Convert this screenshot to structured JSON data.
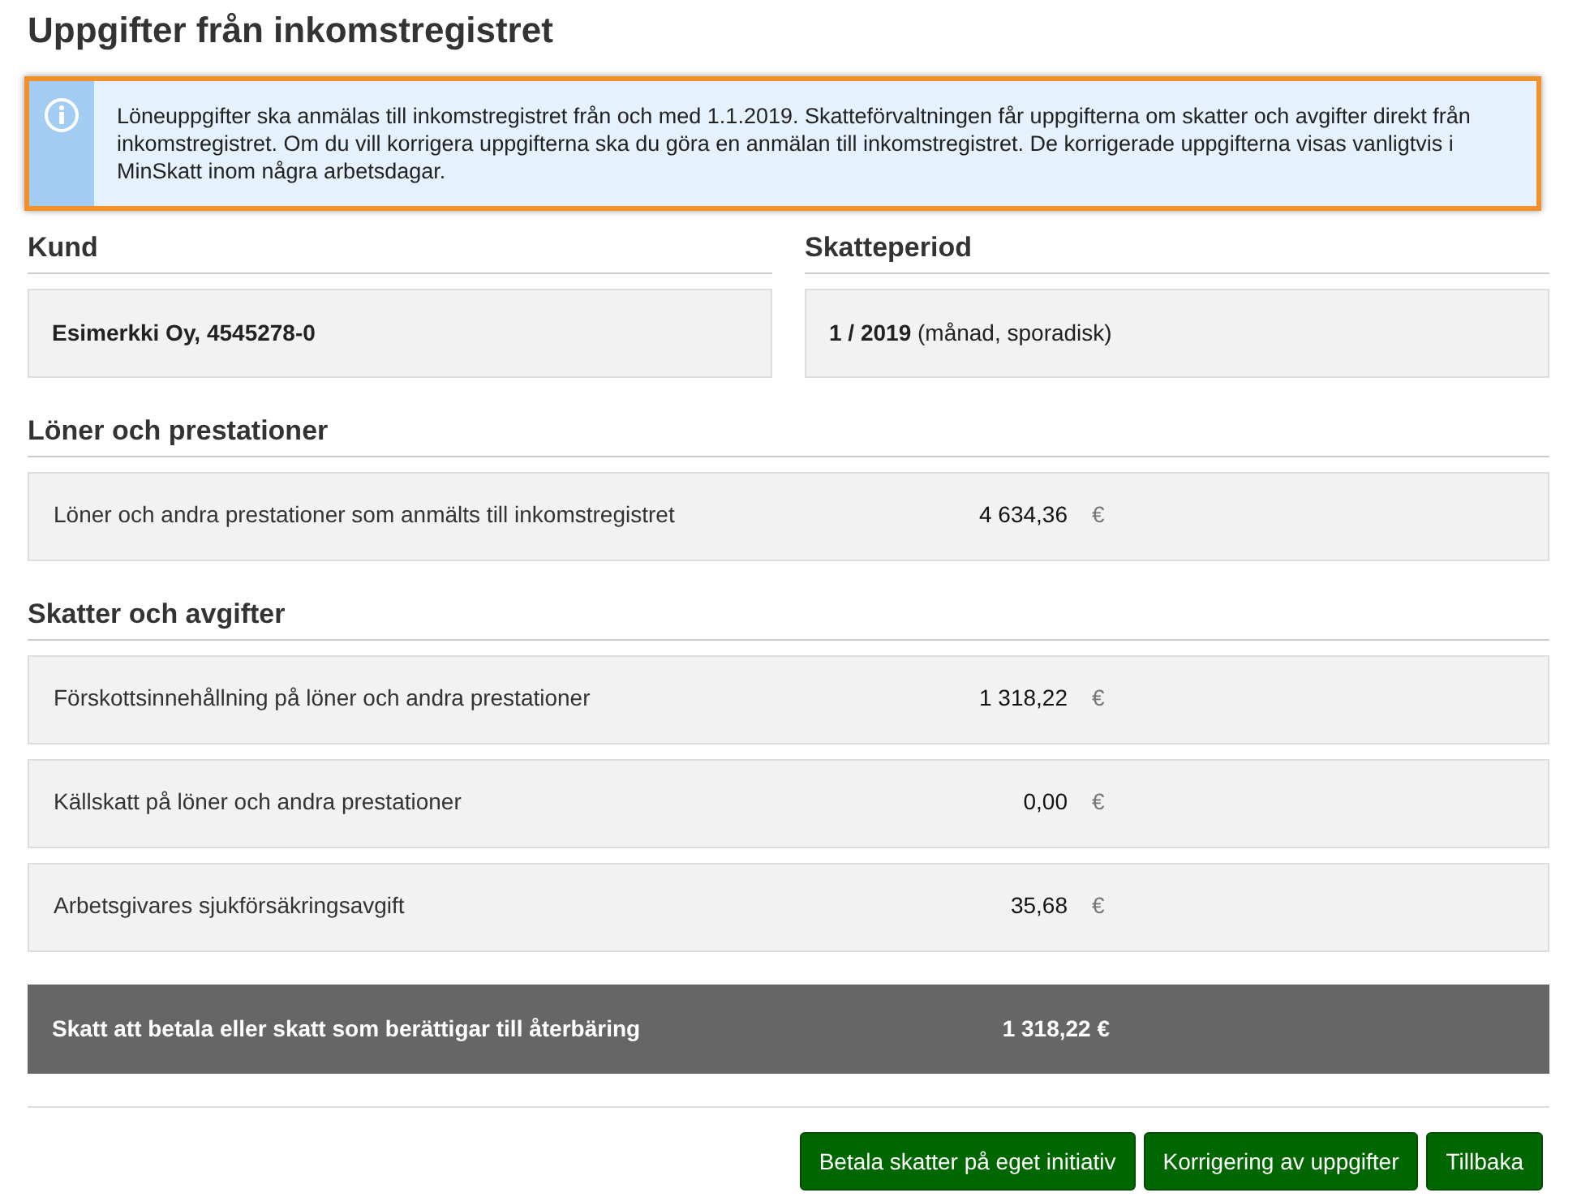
{
  "title": "Uppgifter från inkomstregistret",
  "notice": {
    "text": "Löneuppgifter ska anmälas till inkomstregistret från och med 1.1.2019. Skatteförvaltningen får uppgifterna om skatter och avgifter direkt från inkomstregistret. Om du vill korrigera uppgifterna ska du göra en anmälan till inkomstregistret. De korrigerade uppgifterna visas vanligtvis i MinSkatt inom några arbetsdagar."
  },
  "customer": {
    "heading": "Kund",
    "value": "Esimerkki Oy, 4545278-0"
  },
  "tax_period": {
    "heading": "Skatteperiod",
    "value": "**1 / 2019** (månad, sporadisk)"
  },
  "sections": [
    {
      "heading": "Löner och prestationer",
      "rows": [
        {
          "label": "Löner och andra prestationer som anmälts till inkomstregistret",
          "amount": "4 634,36",
          "currency": "€"
        }
      ]
    },
    {
      "heading": "Skatter och avgifter",
      "rows": [
        {
          "label": "Förskottsinnehållning på löner och andra prestationer",
          "amount": "1 318,22",
          "currency": "€"
        },
        {
          "label": "Källskatt på löner och andra prestationer",
          "amount": "0,00",
          "currency": "€"
        },
        {
          "label": "Arbetsgivares sjukförsäkringsavgift",
          "amount": "35,68",
          "currency": "€"
        }
      ]
    }
  ],
  "total": {
    "label": "Skatt att betala eller skatt som berättigar till återbäring",
    "amount": "1 318,22 €"
  },
  "buttons": [
    "Betala skatter på eget initiativ",
    "Korrigering av uppgifter",
    "Tillbaka"
  ]
}
